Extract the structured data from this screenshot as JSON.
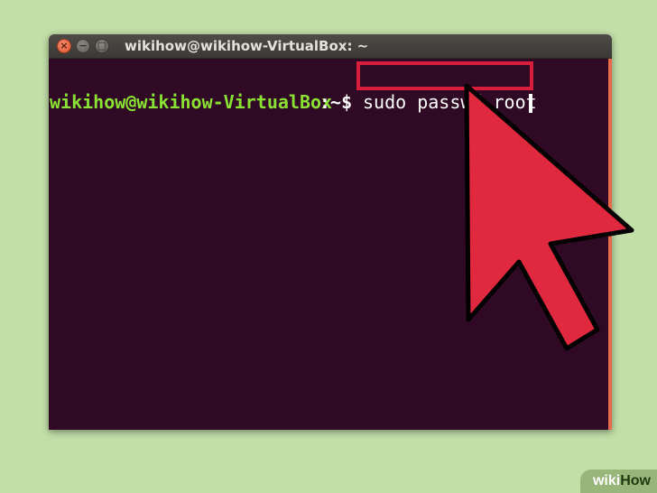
{
  "window": {
    "title": "wikihow@wikihow-VirtualBox: ~",
    "close_glyph": "×",
    "minimize_glyph": "−",
    "maximize_glyph": "□"
  },
  "terminal": {
    "user_host": "wikihow@wikihow-VirtualBox",
    "path_prompt": ":~$",
    "command": "sudo passwd root"
  },
  "annotation": {
    "icon": "pointer-arrow-icon",
    "color": "#e0283e"
  },
  "watermark": {
    "part1": "wiki",
    "part2": "How"
  },
  "colors": {
    "background": "#c2dfa8",
    "terminal_bg": "#300a24",
    "prompt_user": "#8ae234",
    "highlight": "#d91e3d"
  }
}
